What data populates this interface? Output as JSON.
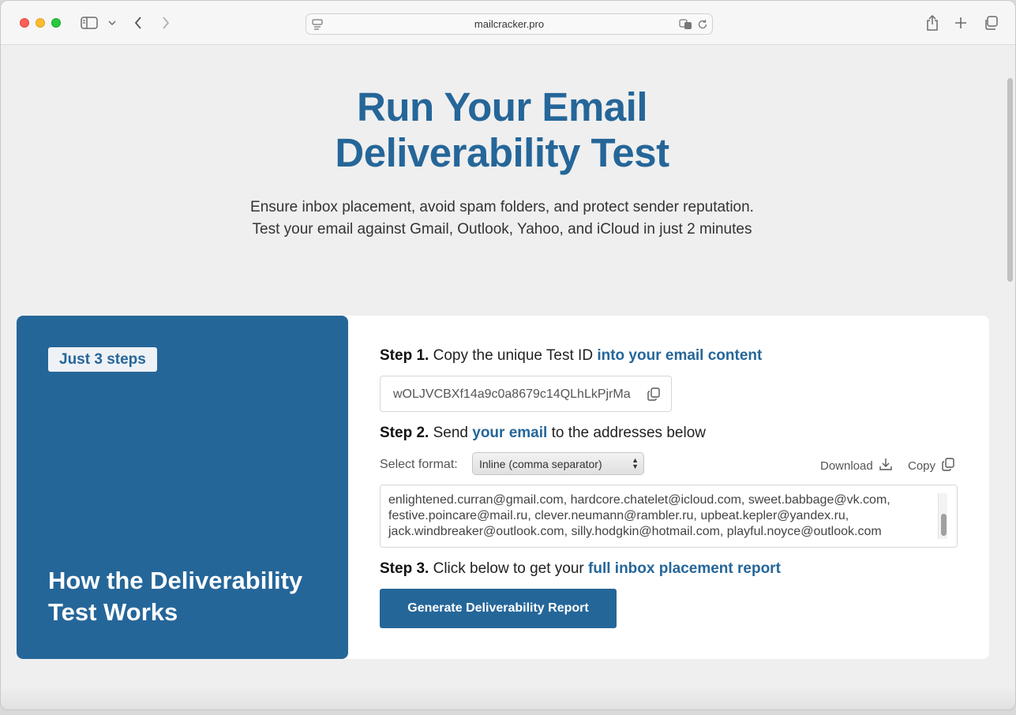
{
  "browser": {
    "url": "mailcracker.pro",
    "icons": [
      "sidebar-icon",
      "chevron-down-icon",
      "back-icon",
      "forward-icon",
      "page-icon",
      "translate-icon",
      "reload-icon",
      "share-icon",
      "new-tab-icon",
      "tabs-overview-icon"
    ]
  },
  "hero": {
    "title_line1": "Run Your Email",
    "title_line2": "Deliverability Test",
    "sub_line1": "Ensure inbox placement, avoid spam folders, and protect sender reputation.",
    "sub_line2": "Test your email against Gmail, Outlook, Yahoo, and iCloud in just 2 minutes"
  },
  "left_panel": {
    "badge": "Just 3 steps",
    "title": "How the Deliverability Test Works"
  },
  "step1": {
    "label": "Step 1.",
    "text": "Copy the unique Test ID",
    "highlight": "into your email content",
    "test_id": "wOLJVCBXf14a9c0a8679c14QLhLkPjrMa"
  },
  "step2": {
    "label": "Step 2.",
    "text_before": "Send",
    "highlight": "your email",
    "text_after": "to the addresses below",
    "format_label": "Select format:",
    "format_value": "Inline (comma separator)",
    "download_label": "Download",
    "copy_label": "Copy",
    "emails": "enlightened.curran@gmail.com, hardcore.chatelet@icloud.com, sweet.babbage@vk.com, festive.poincare@mail.ru, clever.neumann@rambler.ru, upbeat.kepler@yandex.ru, jack.windbreaker@outlook.com, silly.hodgkin@hotmail.com, playful.noyce@outlook.com"
  },
  "step3": {
    "label": "Step 3.",
    "text": "Click below to get your",
    "highlight": "full inbox placement report",
    "button": "Generate Deliverability Report"
  },
  "colors": {
    "brand": "#256699",
    "background": "#efefef"
  }
}
